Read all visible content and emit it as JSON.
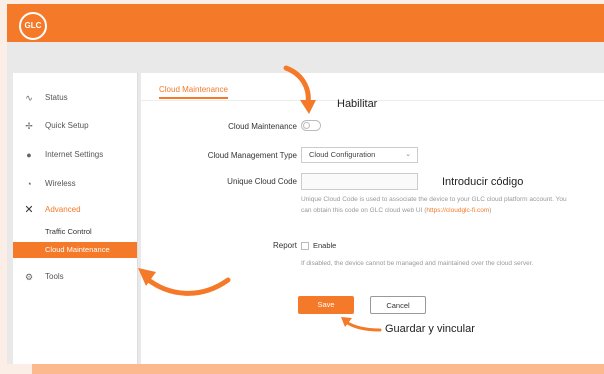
{
  "brand": {
    "logo_text": "GLC",
    "accent": "#f47a2a"
  },
  "sidebar": {
    "items": [
      {
        "label": "Status",
        "icon": "activity-icon"
      },
      {
        "label": "Quick Setup",
        "icon": "quick-setup-icon"
      },
      {
        "label": "Internet Settings",
        "icon": "globe-icon"
      },
      {
        "label": "Wireless",
        "icon": "wifi-icon"
      },
      {
        "label": "Advanced",
        "icon": "tools-cross-icon"
      }
    ],
    "advanced_sub": [
      {
        "label": "Traffic Control"
      },
      {
        "label": "Cloud Maintenance"
      }
    ],
    "tools": {
      "label": "Tools",
      "icon": "gear-icon"
    }
  },
  "main": {
    "title": "Cloud Maintenance",
    "cloud_maintenance_label": "Cloud Maintenance",
    "management_type_label": "Cloud Management Type",
    "management_type_value": "Cloud Configuration",
    "unique_code_label": "Unique Cloud Code",
    "unique_code_value": "",
    "help_text": "Unique Cloud Code is used to associate the device to your GLC cloud platform account. You can obtain this code on GLC cloud web UI (",
    "help_link": "https://cloudglc-fi.com",
    "help_close": ")",
    "report_label": "Report",
    "report_option": "Enable",
    "report_help": "If disabled, the device cannot be managed and maintained over the cloud server.",
    "save_label": "Save",
    "cancel_label": "Cancel"
  },
  "annotations": {
    "enable": "Habilitar",
    "enter_code": "Introducir código",
    "save_link": "Guardar y vincular"
  }
}
